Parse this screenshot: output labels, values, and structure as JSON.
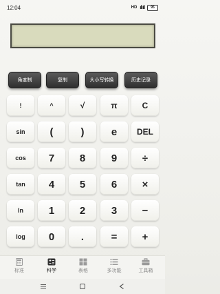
{
  "status": {
    "time": "12:04",
    "network": "HD",
    "signal": "ıll ıll",
    "battery": "95"
  },
  "display": {
    "value": ""
  },
  "function_buttons": [
    "角度制",
    "复制",
    "大小写转换",
    "历史记录"
  ],
  "keys": [
    [
      "!",
      "^",
      "√",
      "π",
      "C"
    ],
    [
      "sin",
      "(",
      ")",
      "e",
      "DEL"
    ],
    [
      "cos",
      "7",
      "8",
      "9",
      "÷"
    ],
    [
      "tan",
      "4",
      "5",
      "6",
      "×"
    ],
    [
      "ln",
      "1",
      "2",
      "3",
      "−"
    ],
    [
      "log",
      "0",
      ".",
      "=",
      "+"
    ]
  ],
  "tabs": [
    {
      "label": "标准",
      "icon": "calculator-icon",
      "active": false
    },
    {
      "label": "科学",
      "icon": "scientific-calculator-icon",
      "active": true
    },
    {
      "label": "表格",
      "icon": "grid-icon",
      "active": false
    },
    {
      "label": "多功能",
      "icon": "list-icon",
      "active": false
    },
    {
      "label": "工具箱",
      "icon": "toolbox-icon",
      "active": false
    }
  ],
  "navigation": [
    "menu",
    "home",
    "back"
  ]
}
